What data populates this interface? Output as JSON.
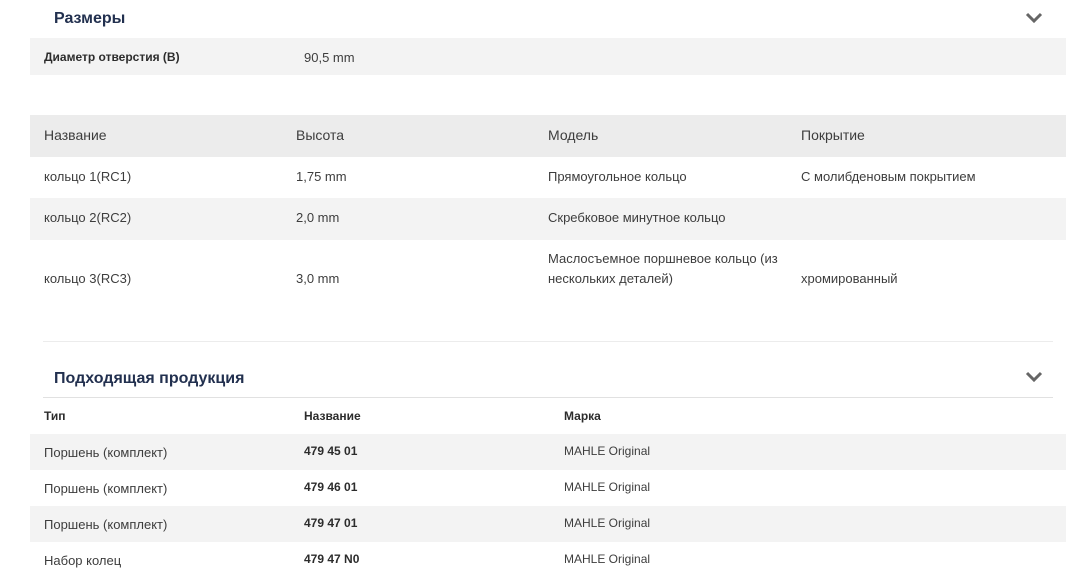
{
  "dimensions": {
    "title": "Размеры",
    "row": {
      "label": "Диаметр отверстия (B)",
      "value": "90,5 mm"
    }
  },
  "rings": {
    "headers": [
      "Название",
      "Высота",
      "Модель",
      "Покрытие"
    ],
    "rows": [
      {
        "name": "кольцо 1(RC1)",
        "height": "1,75 mm",
        "model": "Прямоугольное кольцо",
        "coating": "С молибденовым покрытием"
      },
      {
        "name": "кольцо 2(RC2)",
        "height": "2,0 mm",
        "model": "Скребковое минутное кольцо",
        "coating": ""
      },
      {
        "name": "кольцо 3(RC3)",
        "height": "3,0 mm",
        "model_line1": "Маслосъемное поршневое кольцо (из",
        "model_line2": "нескольких деталей)",
        "coating": "хромированный"
      }
    ]
  },
  "products": {
    "title": "Подходящая продукция",
    "headers": [
      "Тип",
      "Название",
      "Марка"
    ],
    "rows": [
      {
        "type": "Поршень (комплект)",
        "name": "479 45 01",
        "brand": "MAHLE Original"
      },
      {
        "type": "Поршень (комплект)",
        "name": "479 46 01",
        "brand": "MAHLE Original"
      },
      {
        "type": "Поршень (комплект)",
        "name": "479 47 01",
        "brand": "MAHLE Original"
      },
      {
        "type": "Набор колец",
        "name": "479 47 N0",
        "brand": "MAHLE Original"
      }
    ]
  },
  "icons": {
    "collapse": "chevron-down-icon"
  },
  "colors": {
    "title": "#22304f",
    "row_bg": "#f3f3f3",
    "divider": "#e1e1e1",
    "chevron": "#666666"
  }
}
